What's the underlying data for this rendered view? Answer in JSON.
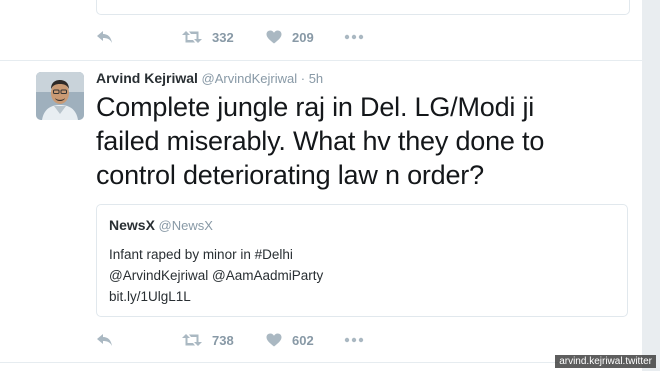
{
  "prev_tweet": {
    "retweets": "332",
    "likes": "209"
  },
  "tweet": {
    "name": "Arvind Kejriwal",
    "handle": "@ArvindKejriwal",
    "separator": "·",
    "time": "5h",
    "text_lines": [
      "Complete jungle raj in Del. LG/Modi ji",
      "failed miserably. What hv they done to",
      "control deteriorating law n order?"
    ],
    "retweets": "738",
    "likes": "602"
  },
  "quoted": {
    "name": "NewsX",
    "handle": "@NewsX",
    "lines": [
      "Infant raped by minor in #Delhi",
      "@ArvindKejriwal @AamAadmiParty",
      "bit.ly/1UlgL1L"
    ]
  },
  "watermark": "arvind.kejriwal.twitter",
  "icons": {
    "reply": "reply-icon",
    "retweet": "retweet-icon",
    "like": "heart-icon",
    "more": "more-dots-icon"
  },
  "colors": {
    "icon": "#aab8c2",
    "muted": "#8899a6",
    "text": "#14171a",
    "border": "#e1e8ed"
  }
}
